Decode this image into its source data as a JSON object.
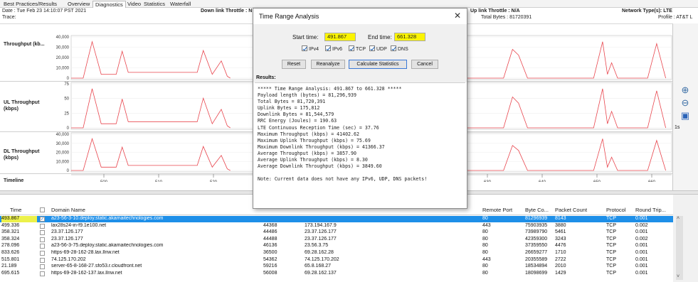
{
  "tabs": [
    "Best Practices/Results",
    "Overview",
    "Diagnostics",
    "Video",
    "Statistics",
    "Waterfall"
  ],
  "active_tab": "Diagnostics",
  "info": {
    "date": "Date : Tue Feb 23 14:10:07 PST 2021",
    "trace_label": "Trace:",
    "trace_value": "",
    "downlink_throttle": "Down link Throttle : N",
    "uplink_throttle": "Up link Throttle : N/A",
    "total_bytes": "Total Bytes : 81720391",
    "network_type": "Network Type(s):  LTE",
    "profile": "Profile : AT&T L"
  },
  "chart_rows": [
    {
      "label": "Throughput (kb...",
      "yticks": [
        "40,000",
        "30,000",
        "20,000",
        "10,000",
        "0"
      ]
    },
    {
      "label": "UL Throughput (kbps)",
      "yticks": [
        "75",
        "50",
        "25",
        "0"
      ]
    },
    {
      "label": "DL Throughput (kbps)",
      "yticks": [
        "40,000",
        "30,000",
        "20,000",
        "10,000",
        "0"
      ]
    },
    {
      "label": "Timeline",
      "yticks": []
    }
  ],
  "timeline_ticks": [
    "500",
    "510",
    "520",
    "530",
    "540",
    "610",
    "620",
    "630",
    "640",
    "650",
    "660"
  ],
  "scale_readout": "1s",
  "dialog": {
    "title": "Time Range Analysis",
    "start_label": "Start time:",
    "start_value": "491.867",
    "end_label": "End time:",
    "end_value": "661.328",
    "checkboxes": [
      "IPv4",
      "IPv6",
      "TCP",
      "UDP",
      "DNS"
    ],
    "buttons": [
      "Reset",
      "Reanalyze",
      "Calculate Statistics",
      "Cancel"
    ],
    "results_label": "Results:",
    "results_lines": [
      "***** Time Range Analysis: 491.867 to 661.328 *****",
      "Payload length (bytes) = 81,296,939",
      "Total Bytes = 81,720,391",
      "Uplink Bytes = 175,812",
      "Downlink Bytes = 81,544,579",
      "RRC Energy (Joules) = 190.63",
      "LTE Continuous Reception Time (sec) = 37.76",
      "Maximum Throughput (kbps) = 41402.62",
      "Maximum Uplink Throughput (kbps) = 75.69",
      "Maximum Downlink Throughput (kbps) = 41366.37",
      "Average Throughput (kbps) = 3857.90",
      "Average Uplink Throughput (kbps) = 8.30",
      "Average Downlink Throughput (kbps) = 3849.60",
      "",
      "Note: Current data does not have any IPv6, UDP, DNS packets!"
    ]
  },
  "table": {
    "headers": [
      "Time",
      "Domain Name",
      "Remote Port",
      "Byte Co...",
      "Packet Count",
      "Protocol",
      "Round Trip..."
    ],
    "rows": [
      {
        "time": "493.867",
        "domain": "a23-56-3-10.deploy.static.akamaitechnologies.com",
        "local_port": "",
        "remote_ip": "",
        "remote_port": "80",
        "bytes": "81296939",
        "packets": "8143",
        "protocol": "TCP",
        "rtt": "0.001",
        "selected": true
      },
      {
        "time": "499.336",
        "domain": "lax28s24-in-f9.1e100.net",
        "local_port": "44368",
        "remote_ip": "173.194.167.9",
        "remote_port": "443",
        "bytes": "75903935",
        "packets": "3880",
        "protocol": "TCP",
        "rtt": "0.002"
      },
      {
        "time": "358.321",
        "domain": "23.37.126.177",
        "local_port": "44486",
        "remote_ip": "23.37.126.177",
        "remote_port": "80",
        "bytes": "73989790",
        "packets": "5461",
        "protocol": "TCP",
        "rtt": "0.001"
      },
      {
        "time": "358.324",
        "domain": "23.37.126.177",
        "local_port": "44488",
        "remote_ip": "23.37.126.177",
        "remote_port": "80",
        "bytes": "42359300",
        "packets": "3243",
        "protocol": "TCP",
        "rtt": "0.002"
      },
      {
        "time": "278.096",
        "domain": "a23-56-3-75.deploy.static.akamaitechnologies.com",
        "local_port": "46136",
        "remote_ip": "23.56.3.75",
        "remote_port": "80",
        "bytes": "37359550",
        "packets": "4476",
        "protocol": "TCP",
        "rtt": "0.001"
      },
      {
        "time": "833.626",
        "domain": "https-69-28-162-28.lax.llnw.net",
        "local_port": "36500",
        "remote_ip": "69.28.162.28",
        "remote_port": "80",
        "bytes": "26659277",
        "packets": "1710",
        "protocol": "TCP",
        "rtt": "0.001"
      },
      {
        "time": "515.801",
        "domain": "74.125.170.202",
        "local_port": "54362",
        "remote_ip": "74.125.170.202",
        "remote_port": "443",
        "bytes": "20355589",
        "packets": "2722",
        "protocol": "TCP",
        "rtt": "0.001"
      },
      {
        "time": "21.189",
        "domain": "server-65-8-168-27.sfo53.r.cloudfront.net",
        "local_port": "59216",
        "remote_ip": "65.8.168.27",
        "remote_port": "80",
        "bytes": "18534894",
        "packets": "2010",
        "protocol": "TCP",
        "rtt": "0.001"
      },
      {
        "time": "695.615",
        "domain": "https-69-28-162-137.lax.llnw.net",
        "local_port": "56008",
        "remote_ip": "69.28.162.137",
        "remote_port": "80",
        "bytes": "18098699",
        "packets": "1429",
        "protocol": "TCP",
        "rtt": "0.001"
      }
    ]
  },
  "colors": {
    "trace": "#e8454d",
    "selection": "#1e8fe8",
    "highlight": "#fbf400"
  }
}
